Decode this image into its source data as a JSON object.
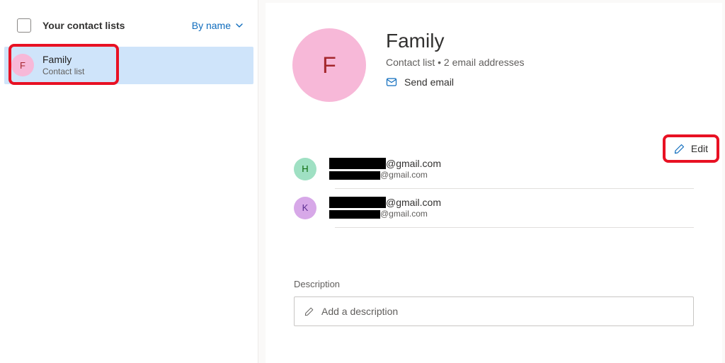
{
  "sidebar": {
    "checkbox_checked": false,
    "title": "Your contact lists",
    "sort_label": "By name",
    "items": [
      {
        "name": "Family",
        "subtitle": "Contact list",
        "initial": "F"
      }
    ]
  },
  "detail": {
    "initial": "F",
    "title": "Family",
    "subtitle": "Contact list • 2 email addresses",
    "send_email_label": "Send email",
    "edit_label": "Edit",
    "members": [
      {
        "initial": "H",
        "avatar_bg": "#9fe0c3",
        "avatar_fg": "#0b6a0b",
        "name_redacted": true,
        "domain": "@gmail.com",
        "email_redacted": true,
        "email_domain": "@gmail.com"
      },
      {
        "initial": "K",
        "avatar_bg": "#d7a8e8",
        "avatar_fg": "#5c2e91",
        "name_redacted": true,
        "domain": "@gmail.com",
        "email_redacted": true,
        "email_domain": "@gmail.com"
      }
    ],
    "description_label": "Description",
    "description_placeholder": "Add a description"
  },
  "annotations": {
    "highlight_list_item": true,
    "highlight_edit": true
  }
}
